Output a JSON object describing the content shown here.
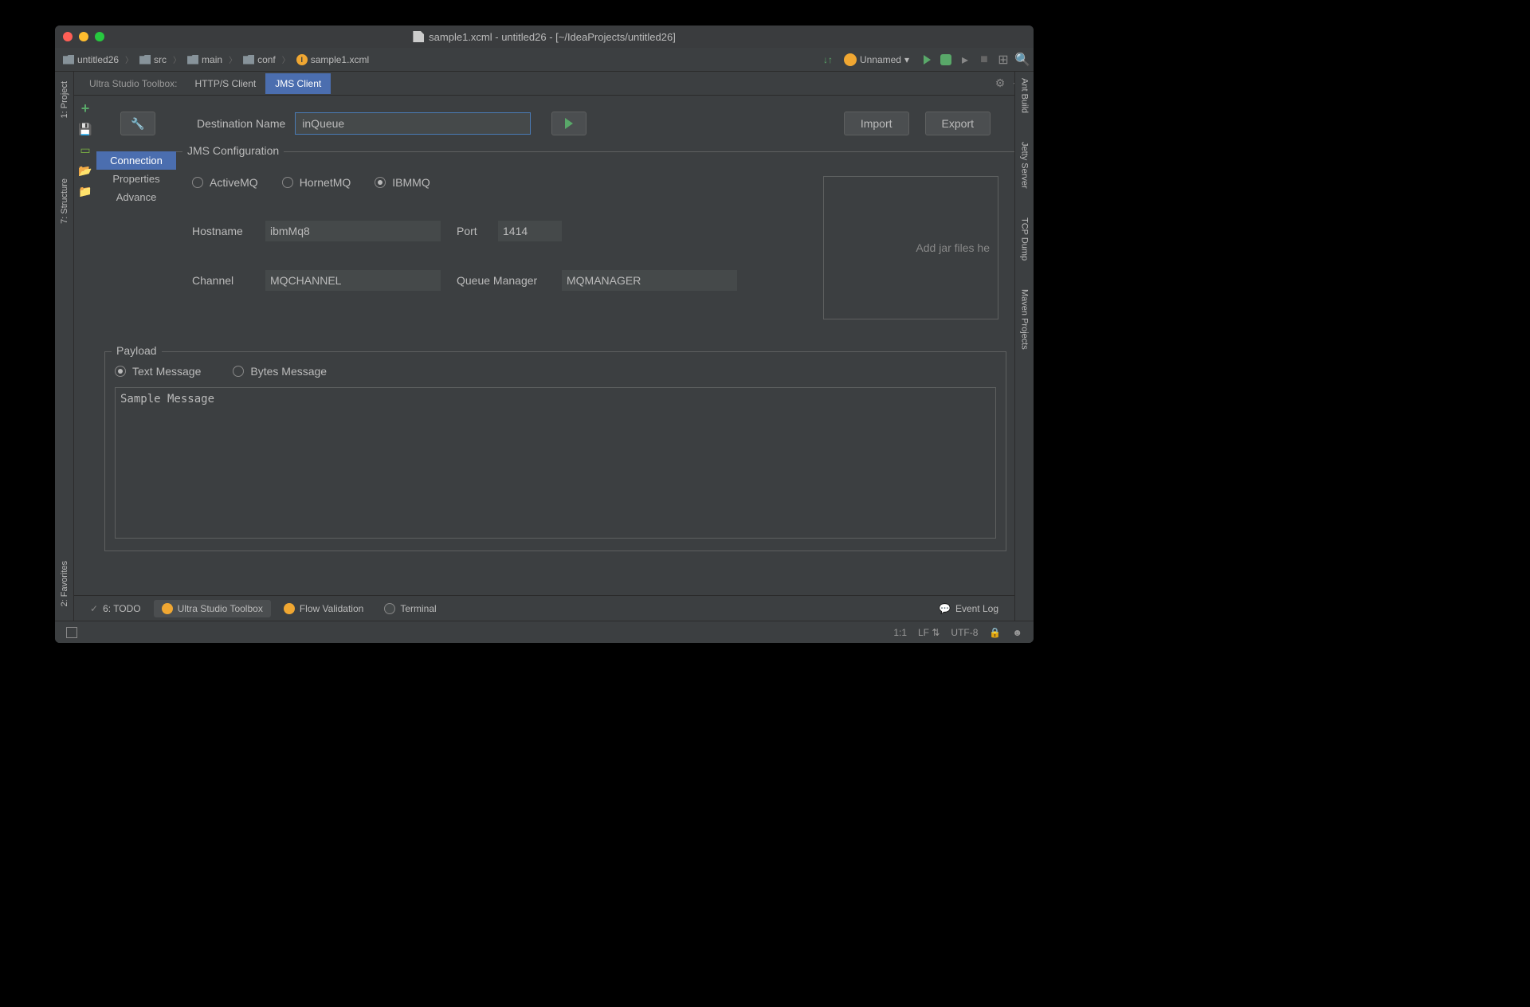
{
  "window": {
    "title": "sample1.xcml - untitled26 - [~/IdeaProjects/untitled26]"
  },
  "breadcrumb": {
    "items": [
      "untitled26",
      "src",
      "main",
      "conf",
      "sample1.xcml"
    ]
  },
  "nav": {
    "run_config": "Unnamed"
  },
  "toolbox": {
    "label": "Ultra Studio Toolbox:",
    "tabs": [
      "HTTP/S Client",
      "JMS Client"
    ],
    "active_tab": 1
  },
  "left_rail": {
    "tabs": [
      "1: Project",
      "7: Structure",
      "2: Favorites"
    ]
  },
  "right_rail": {
    "tabs": [
      "Ant Build",
      "Jetty Server",
      "TCP Dump",
      "Maven Projects"
    ]
  },
  "top_controls": {
    "dest_label": "Destination Name",
    "dest_value": "inQueue",
    "import_label": "Import",
    "export_label": "Export"
  },
  "config_tabs": {
    "items": [
      "Connection",
      "Properties",
      "Advance"
    ],
    "active": 0
  },
  "jms": {
    "fieldset_label": "JMS Configuration",
    "providers": [
      "ActiveMQ",
      "HornetMQ",
      "IBMMQ"
    ],
    "selected_provider": 2,
    "hostname_label": "Hostname",
    "hostname_value": "ibmMq8",
    "port_label": "Port",
    "port_value": "1414",
    "channel_label": "Channel",
    "channel_value": "MQCHANNEL",
    "qm_label": "Queue Manager",
    "qm_value": "MQMANAGER",
    "jar_placeholder": "Add jar files he"
  },
  "payload": {
    "fieldset_label": "Payload",
    "types": [
      "Text Message",
      "Bytes Message"
    ],
    "selected_type": 0,
    "content": "Sample Message"
  },
  "bottom_bar": {
    "items": [
      "6: TODO",
      "Ultra Studio Toolbox",
      "Flow Validation",
      "Terminal"
    ],
    "active": 1,
    "event_log": "Event Log"
  },
  "status_bar": {
    "position": "1:1",
    "line_ending": "LF",
    "encoding": "UTF-8"
  }
}
